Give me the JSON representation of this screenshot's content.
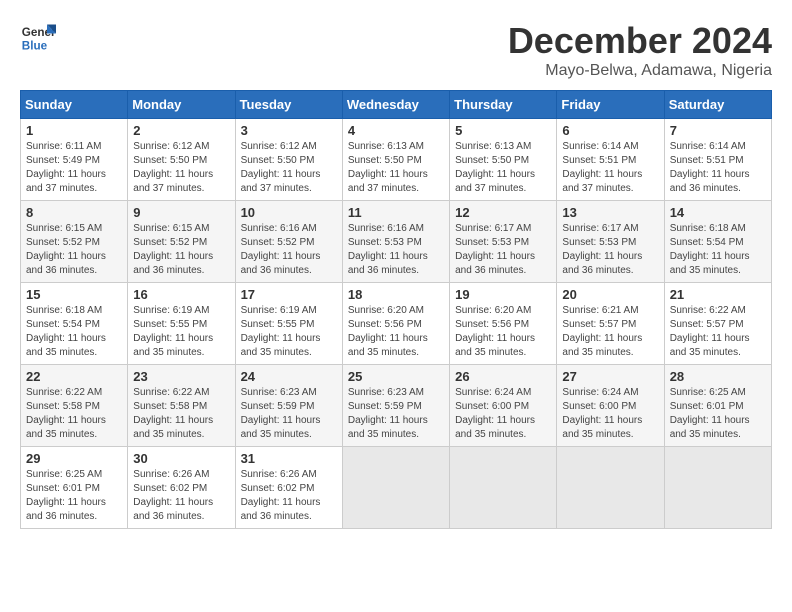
{
  "logo": {
    "line1": "General",
    "line2": "Blue"
  },
  "title": "December 2024",
  "location": "Mayo-Belwa, Adamawa, Nigeria",
  "days_header": [
    "Sunday",
    "Monday",
    "Tuesday",
    "Wednesday",
    "Thursday",
    "Friday",
    "Saturday"
  ],
  "weeks": [
    [
      {
        "day": "1",
        "info": "Sunrise: 6:11 AM\nSunset: 5:49 PM\nDaylight: 11 hours\nand 37 minutes."
      },
      {
        "day": "2",
        "info": "Sunrise: 6:12 AM\nSunset: 5:50 PM\nDaylight: 11 hours\nand 37 minutes."
      },
      {
        "day": "3",
        "info": "Sunrise: 6:12 AM\nSunset: 5:50 PM\nDaylight: 11 hours\nand 37 minutes."
      },
      {
        "day": "4",
        "info": "Sunrise: 6:13 AM\nSunset: 5:50 PM\nDaylight: 11 hours\nand 37 minutes."
      },
      {
        "day": "5",
        "info": "Sunrise: 6:13 AM\nSunset: 5:50 PM\nDaylight: 11 hours\nand 37 minutes."
      },
      {
        "day": "6",
        "info": "Sunrise: 6:14 AM\nSunset: 5:51 PM\nDaylight: 11 hours\nand 37 minutes."
      },
      {
        "day": "7",
        "info": "Sunrise: 6:14 AM\nSunset: 5:51 PM\nDaylight: 11 hours\nand 36 minutes."
      }
    ],
    [
      {
        "day": "8",
        "info": "Sunrise: 6:15 AM\nSunset: 5:52 PM\nDaylight: 11 hours\nand 36 minutes."
      },
      {
        "day": "9",
        "info": "Sunrise: 6:15 AM\nSunset: 5:52 PM\nDaylight: 11 hours\nand 36 minutes."
      },
      {
        "day": "10",
        "info": "Sunrise: 6:16 AM\nSunset: 5:52 PM\nDaylight: 11 hours\nand 36 minutes."
      },
      {
        "day": "11",
        "info": "Sunrise: 6:16 AM\nSunset: 5:53 PM\nDaylight: 11 hours\nand 36 minutes."
      },
      {
        "day": "12",
        "info": "Sunrise: 6:17 AM\nSunset: 5:53 PM\nDaylight: 11 hours\nand 36 minutes."
      },
      {
        "day": "13",
        "info": "Sunrise: 6:17 AM\nSunset: 5:53 PM\nDaylight: 11 hours\nand 36 minutes."
      },
      {
        "day": "14",
        "info": "Sunrise: 6:18 AM\nSunset: 5:54 PM\nDaylight: 11 hours\nand 35 minutes."
      }
    ],
    [
      {
        "day": "15",
        "info": "Sunrise: 6:18 AM\nSunset: 5:54 PM\nDaylight: 11 hours\nand 35 minutes."
      },
      {
        "day": "16",
        "info": "Sunrise: 6:19 AM\nSunset: 5:55 PM\nDaylight: 11 hours\nand 35 minutes."
      },
      {
        "day": "17",
        "info": "Sunrise: 6:19 AM\nSunset: 5:55 PM\nDaylight: 11 hours\nand 35 minutes."
      },
      {
        "day": "18",
        "info": "Sunrise: 6:20 AM\nSunset: 5:56 PM\nDaylight: 11 hours\nand 35 minutes."
      },
      {
        "day": "19",
        "info": "Sunrise: 6:20 AM\nSunset: 5:56 PM\nDaylight: 11 hours\nand 35 minutes."
      },
      {
        "day": "20",
        "info": "Sunrise: 6:21 AM\nSunset: 5:57 PM\nDaylight: 11 hours\nand 35 minutes."
      },
      {
        "day": "21",
        "info": "Sunrise: 6:22 AM\nSunset: 5:57 PM\nDaylight: 11 hours\nand 35 minutes."
      }
    ],
    [
      {
        "day": "22",
        "info": "Sunrise: 6:22 AM\nSunset: 5:58 PM\nDaylight: 11 hours\nand 35 minutes."
      },
      {
        "day": "23",
        "info": "Sunrise: 6:22 AM\nSunset: 5:58 PM\nDaylight: 11 hours\nand 35 minutes."
      },
      {
        "day": "24",
        "info": "Sunrise: 6:23 AM\nSunset: 5:59 PM\nDaylight: 11 hours\nand 35 minutes."
      },
      {
        "day": "25",
        "info": "Sunrise: 6:23 AM\nSunset: 5:59 PM\nDaylight: 11 hours\nand 35 minutes."
      },
      {
        "day": "26",
        "info": "Sunrise: 6:24 AM\nSunset: 6:00 PM\nDaylight: 11 hours\nand 35 minutes."
      },
      {
        "day": "27",
        "info": "Sunrise: 6:24 AM\nSunset: 6:00 PM\nDaylight: 11 hours\nand 35 minutes."
      },
      {
        "day": "28",
        "info": "Sunrise: 6:25 AM\nSunset: 6:01 PM\nDaylight: 11 hours\nand 35 minutes."
      }
    ],
    [
      {
        "day": "29",
        "info": "Sunrise: 6:25 AM\nSunset: 6:01 PM\nDaylight: 11 hours\nand 36 minutes."
      },
      {
        "day": "30",
        "info": "Sunrise: 6:26 AM\nSunset: 6:02 PM\nDaylight: 11 hours\nand 36 minutes."
      },
      {
        "day": "31",
        "info": "Sunrise: 6:26 AM\nSunset: 6:02 PM\nDaylight: 11 hours\nand 36 minutes."
      },
      {
        "day": "",
        "info": ""
      },
      {
        "day": "",
        "info": ""
      },
      {
        "day": "",
        "info": ""
      },
      {
        "day": "",
        "info": ""
      }
    ]
  ]
}
